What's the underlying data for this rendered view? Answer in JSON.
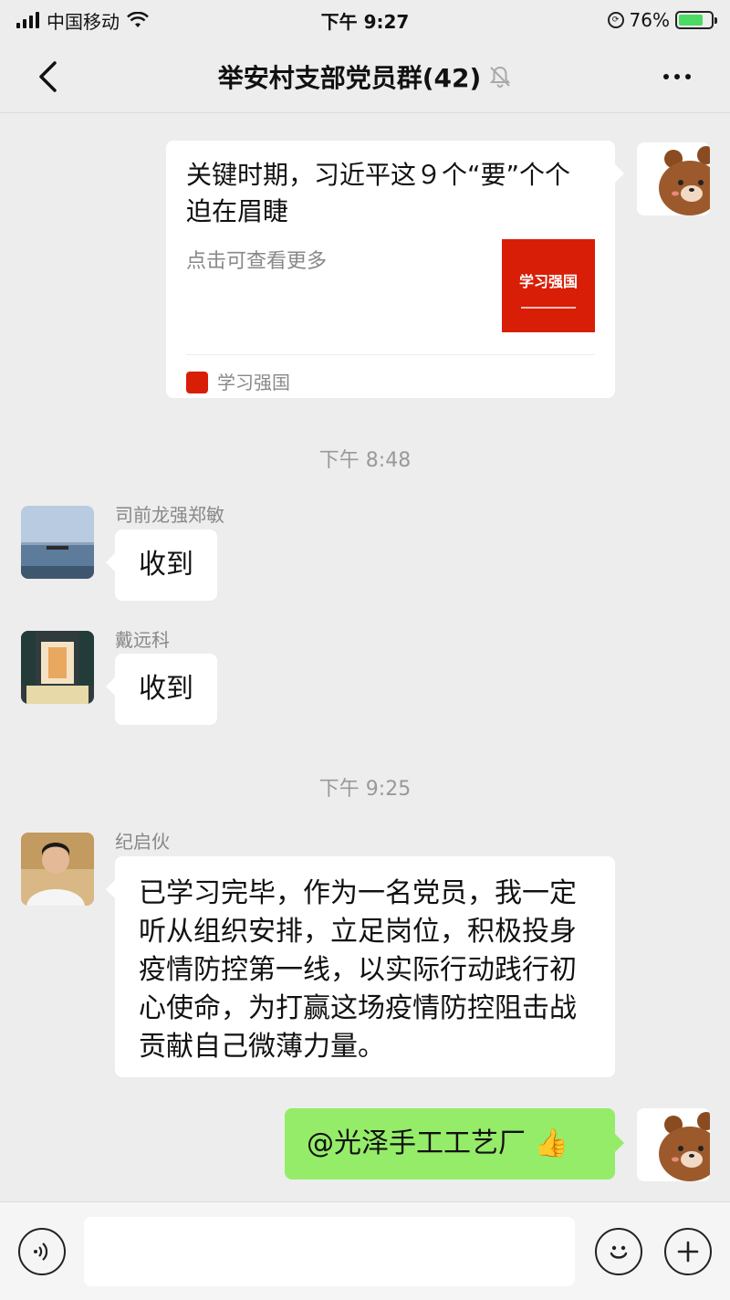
{
  "status_bar": {
    "carrier": "中国移动",
    "time": "下午 9:27",
    "battery": "76%",
    "battery_level": 0.76
  },
  "nav": {
    "title": "举安村支部党员群(42)",
    "icons": [
      "back-arrow-icon",
      "mute-bell-icon",
      "more-dots-icon"
    ]
  },
  "messages": {
    "link_card": {
      "title": "关键时期，习近平这９个“要”个个迫在眉睫",
      "description": "点击可查看更多",
      "source": "学习强国",
      "thumb_text": "学习强国"
    },
    "time_1": "下午 8:48",
    "msg1": {
      "sender": "司前龙强郑敏",
      "text": "收到"
    },
    "msg2": {
      "sender": "戴远科",
      "text": "收到"
    },
    "time_2": "下午 9:25",
    "msg3": {
      "sender": "纪启伙",
      "text": "已学习完毕，作为一名党员，我一定听从组织安排，立足岗位，积极投身疫情防控第一线，以实际行动践行初心使命，为打赢这场疫情防控阻击战贡献自己微薄力量。"
    },
    "msg4": {
      "text": "@光泽手工工艺厂 👍"
    }
  },
  "input_bar": {
    "placeholder": "",
    "icons": [
      "voice-icon",
      "emoji-icon",
      "plus-icon"
    ]
  },
  "colors": {
    "background": "#ededed",
    "self_bubble": "#95ec69",
    "other_bubble": "#ffffff",
    "brand_red": "#d81e06"
  }
}
